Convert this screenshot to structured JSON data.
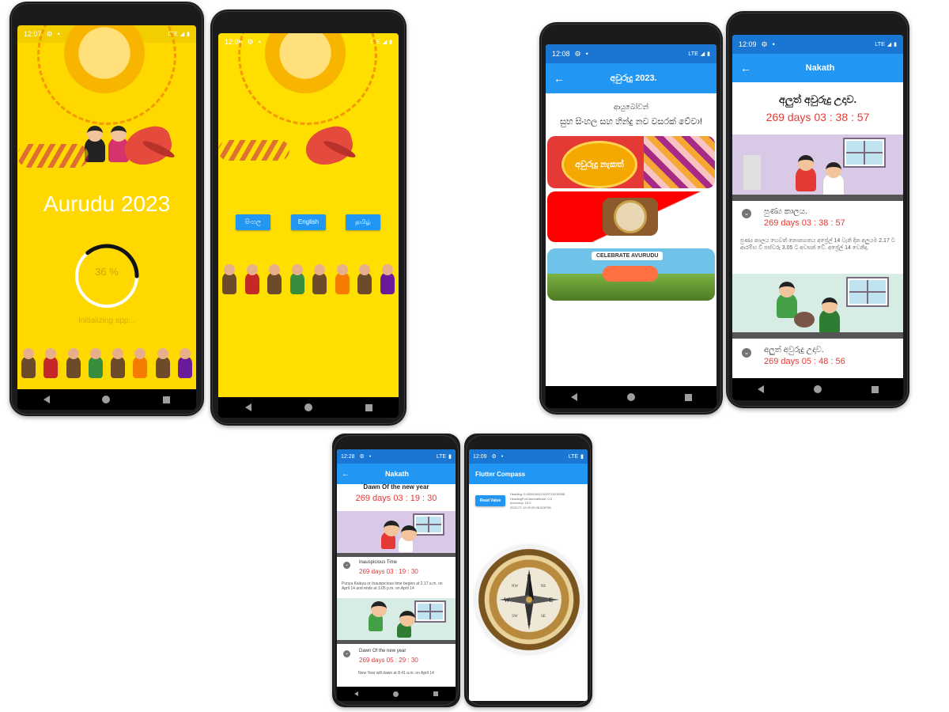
{
  "phone1": {
    "time": "12:07",
    "title": "Aurudu 2023",
    "progress_percent": 36,
    "progress_label": "36 %",
    "status_text": "Initializing app..."
  },
  "phone2": {
    "time": "12:08",
    "lang_buttons": [
      "සිංහල",
      "English",
      "தமிழ்"
    ]
  },
  "phone3": {
    "time": "12:08",
    "appbar_title": "අවුරුදු 2023.",
    "greeting_small": "ආයුබෝවන්",
    "greeting_main": "සුභ සිංහල සහ හින්දු නව වසරක් වේවා!",
    "card1_text": "අවුරුදු නැකත්",
    "card3_banner": "CELEBRATE AVURUDU"
  },
  "phone4": {
    "time": "12:09",
    "appbar_title": "Nakath",
    "heading": "අලුත් අවුරුදු උදාව.",
    "countdown": "269 days 03 : 38 : 57",
    "item1_title": "පුණ්‍ය කාලය.",
    "item1_countdown": "269 days 03 : 38 : 57",
    "item1_desc": "පුණ්‍ය කාලය හෙවත් නොනගතය අප්‍රේල් 14 වැනි දින අලුයම 2.17 ට ආරම්භ වී පස්වරු 3.05 ට අවසන් වේ. අප්‍රේල් 14 වෙනිදා.",
    "item2_title": "අලුත් අවුරුදු උදාව.",
    "item2_countdown": "269 days 05 : 48 : 56"
  },
  "phone5": {
    "time": "12:28",
    "appbar_title": "Nakath",
    "heading": "Dawn Of the new year",
    "countdown": "269 days 03 : 19 : 30",
    "item1_title": "Inauspicious Time",
    "item1_countdown": "269 days 03 : 19 : 30",
    "item1_desc": "Punya Kalaya or Inauspicious time begins at 2.17 a.m. on April 14 and ends at 3.05 p.m. on April 14",
    "item2_title": "Dawn Of the new year",
    "item2_countdown": "269 days 05 : 29 : 30",
    "item2_desc": "New Year will dawn at 8.41 a.m. on April 14"
  },
  "phone6": {
    "time": "12:09",
    "appbar_title": "Flutter Compass",
    "read_button": "Read Value",
    "info_lines": [
      "Heading: 0.0000034123229710236308",
      "HeadingForCameraMode: 0.0",
      "Accuracy: 15.0",
      "2022-07-19 00:09:26.526758"
    ],
    "compass_letters": [
      "N",
      "E",
      "S",
      "W",
      "NE",
      "SE",
      "SW",
      "NW"
    ]
  },
  "status_net": "LTE",
  "colors": {
    "appbar_blue": "#2196f3",
    "splash_yellow": "#ffd800",
    "countdown_red": "#e53935"
  }
}
